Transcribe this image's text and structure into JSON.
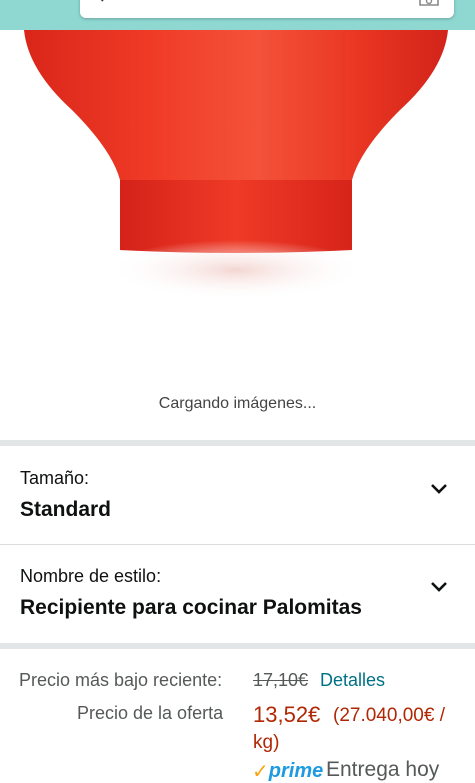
{
  "header": {
    "search_icon": "search-icon",
    "camera_icon": "camera-icon",
    "bar_color": "#8fd8d2"
  },
  "gallery": {
    "loading_text": "Cargando imágenes...",
    "product_color": "#e8321c"
  },
  "variations": [
    {
      "label": "Tamaño:",
      "value": "Standard",
      "icon": "chevron-down-icon"
    },
    {
      "label": "Nombre de estilo:",
      "value": "Recipiente para cocinar Palomitas",
      "icon": "chevron-down-icon"
    }
  ],
  "pricing": {
    "recent_low_label": "Precio más bajo reciente:",
    "recent_low_value": "17,10€",
    "details_link": "Detalles",
    "offer_label": "Precio de la oferta",
    "offer_price": "13,52€",
    "unit_price_line1": "(27.040,00€ /",
    "unit_price_line2": "kg)",
    "price_color": "#b12704",
    "link_color": "#007185"
  },
  "delivery": {
    "prime_check": "✓",
    "prime_label": "prime",
    "text": "Entrega hoy"
  }
}
